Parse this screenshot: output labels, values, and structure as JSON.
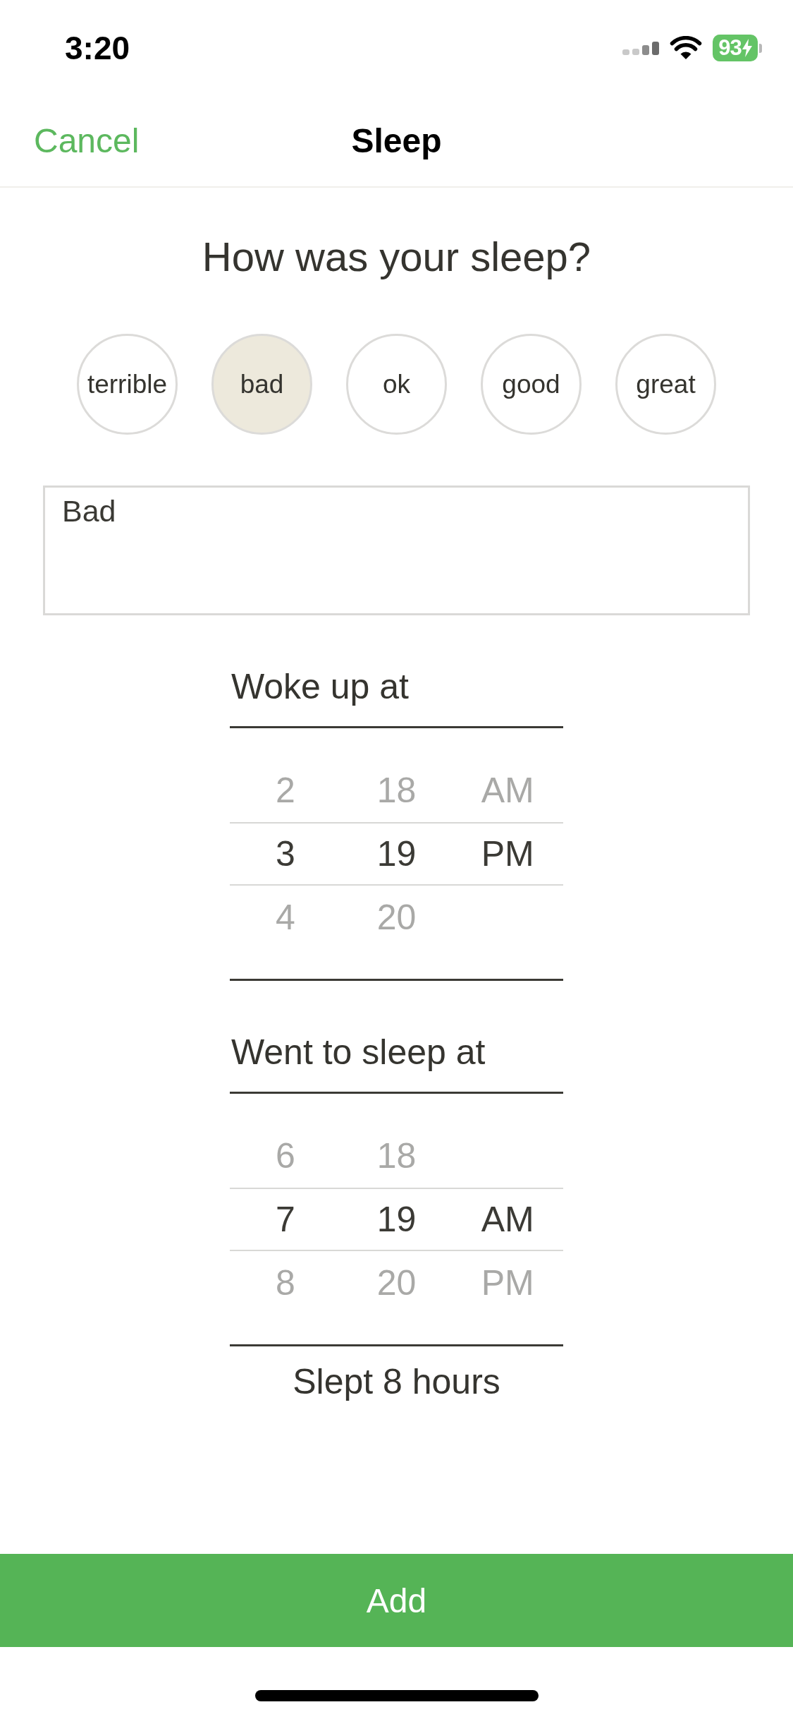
{
  "status_bar": {
    "time": "3:20",
    "battery": {
      "percent": "93",
      "charging": true
    }
  },
  "nav": {
    "cancel": "Cancel",
    "title": "Sleep"
  },
  "question": "How was your sleep?",
  "rating_options": [
    {
      "label": "terrible",
      "selected": false
    },
    {
      "label": "bad",
      "selected": true
    },
    {
      "label": "ok",
      "selected": false
    },
    {
      "label": "good",
      "selected": false
    },
    {
      "label": "great",
      "selected": false
    }
  ],
  "note": {
    "value": "Bad"
  },
  "time_pickers": [
    {
      "label": "Woke up at",
      "rows": [
        {
          "hour": "2",
          "minute": "18",
          "period": "AM",
          "selected": false
        },
        {
          "hour": "3",
          "minute": "19",
          "period": "PM",
          "selected": true
        },
        {
          "hour": "4",
          "minute": "20",
          "selected": false
        }
      ]
    },
    {
      "label": "Went to sleep at",
      "rows": [
        {
          "hour": "6",
          "minute": "18",
          "selected": false
        },
        {
          "hour": "7",
          "minute": "19",
          "period": "AM",
          "selected": true
        },
        {
          "hour": "8",
          "minute": "20",
          "period": "PM",
          "selected": false
        }
      ]
    }
  ],
  "summary": "Slept 8 hours",
  "add_button": "Add"
}
